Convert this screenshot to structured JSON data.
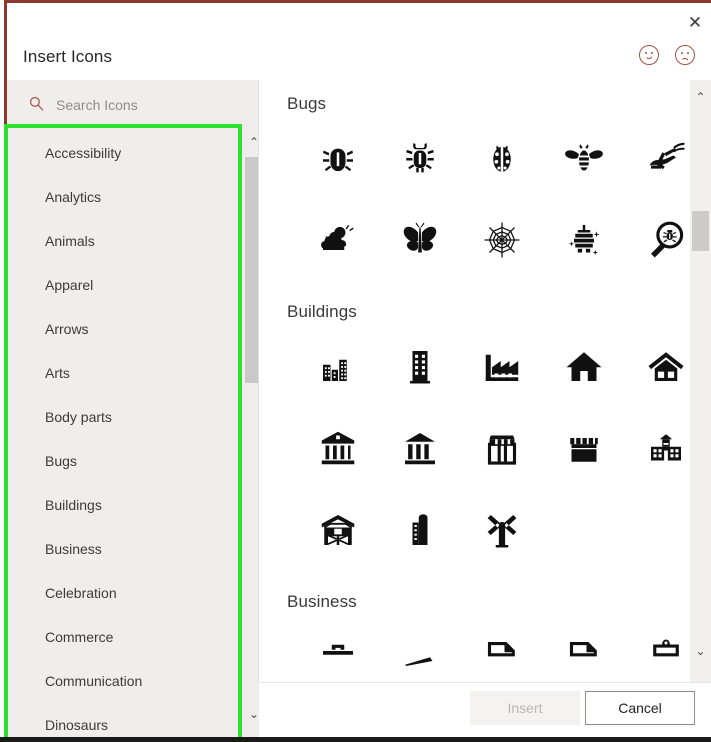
{
  "window": {
    "title": "Insert Icons",
    "close_label": "✕",
    "border_color": "#8a3a2e",
    "highlight_color": "#2ee02e"
  },
  "feedback": {
    "happy_label": "happy-face",
    "sad_label": "sad-face",
    "color": "#a35244"
  },
  "search": {
    "placeholder": "Search Icons",
    "value": "",
    "icon": "search-icon",
    "icon_color": "#a35244"
  },
  "sidebar": {
    "scroll_up_label": "⌃",
    "scroll_down_label": "⌄",
    "items": [
      {
        "label": "Accessibility"
      },
      {
        "label": "Analytics"
      },
      {
        "label": "Animals"
      },
      {
        "label": "Apparel"
      },
      {
        "label": "Arrows"
      },
      {
        "label": "Arts"
      },
      {
        "label": "Body parts"
      },
      {
        "label": "Bugs"
      },
      {
        "label": "Buildings"
      },
      {
        "label": "Business"
      },
      {
        "label": "Celebration"
      },
      {
        "label": "Commerce"
      },
      {
        "label": "Communication"
      },
      {
        "label": "Dinosaurs"
      }
    ]
  },
  "content": {
    "scroll_up_label": "⌃",
    "scroll_down_label": "⌄",
    "groups": [
      {
        "title": "Bugs",
        "icons": [
          "beetle-icon",
          "bug-icon",
          "ladybug-icon",
          "bee-icon",
          "grasshopper-icon",
          "caterpillar-icon",
          "butterfly-icon",
          "spiderweb-icon",
          "beehive-icon",
          "bug-magnifier-icon"
        ]
      },
      {
        "title": "Buildings",
        "icons": [
          "cityscape-icon",
          "office-tower-icon",
          "factory-icon",
          "house-icon",
          "home-roof-icon",
          "bank-icon",
          "museum-icon",
          "shop-icon",
          "market-stall-icon",
          "school-icon",
          "barn-icon",
          "silo-icon",
          "windmill-icon"
        ]
      },
      {
        "title": "Business",
        "icons": [
          "briefcase-icon",
          "pen-icon",
          "document-icon",
          "document-fold-icon",
          "clipboard-icon"
        ]
      }
    ]
  },
  "footer": {
    "insert_label": "Insert",
    "insert_enabled": false,
    "cancel_label": "Cancel"
  }
}
